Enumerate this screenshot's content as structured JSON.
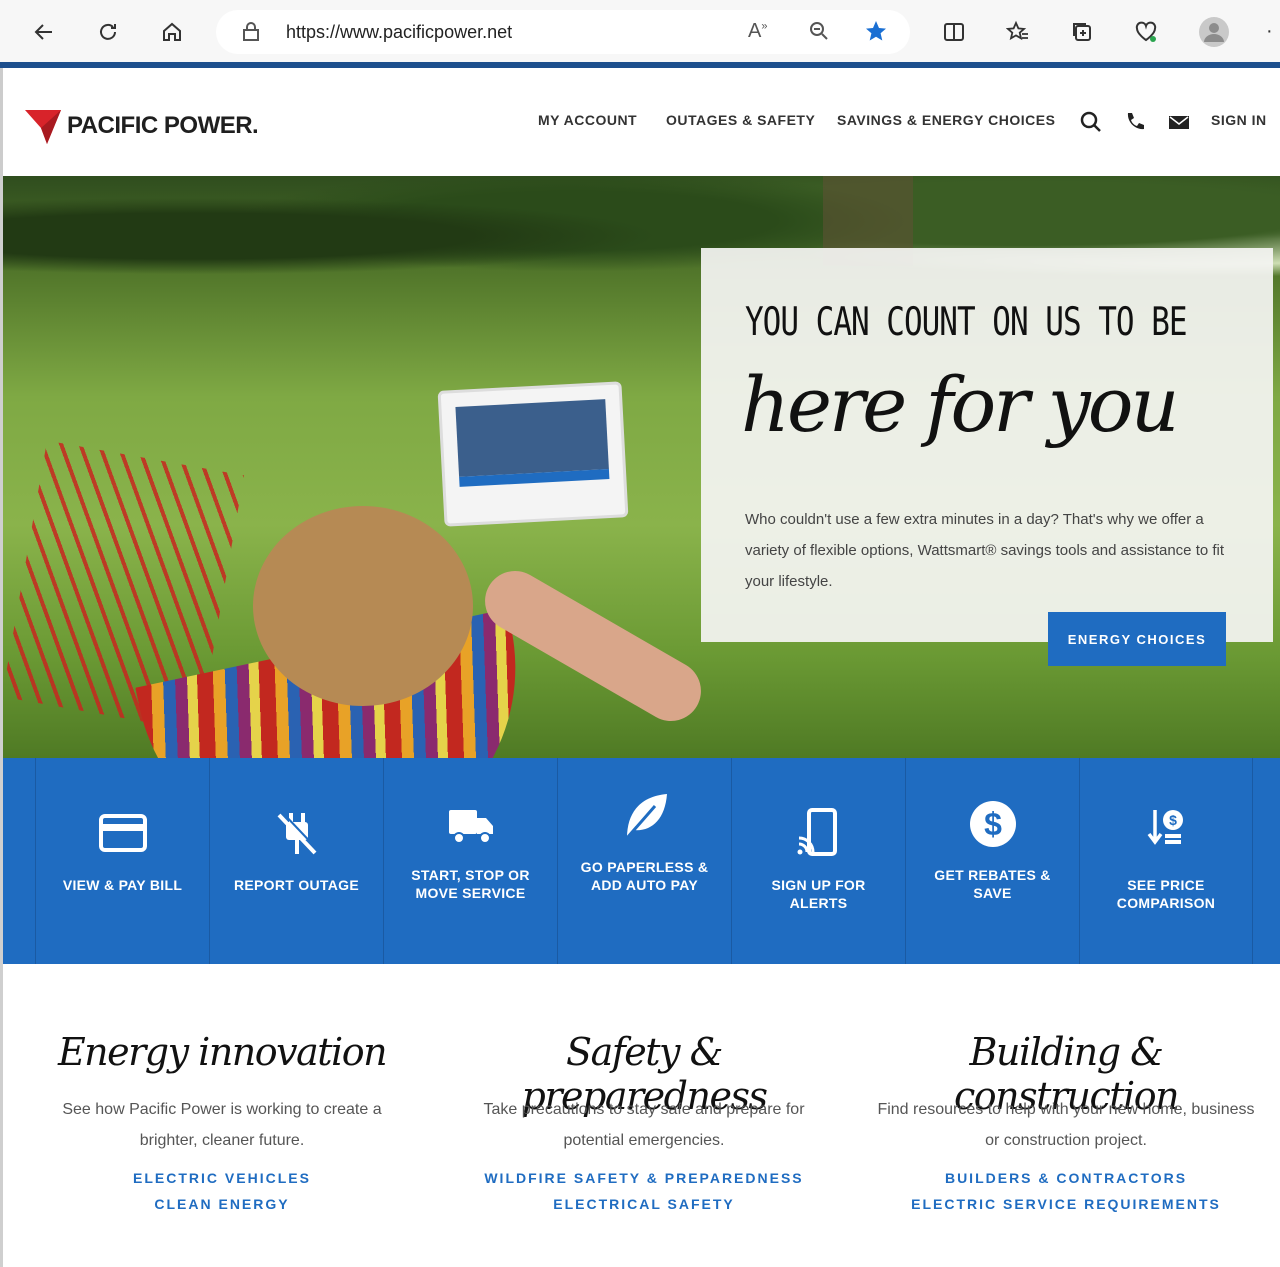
{
  "browser": {
    "url": "https://www.pacificpower.net"
  },
  "header": {
    "logo_text": "PACIFIC POWER.",
    "nav": {
      "my_account": "MY ACCOUNT",
      "outages": "OUTAGES & SAFETY",
      "savings": "SAVINGS & ENERGY CHOICES",
      "sign_in": "SIGN IN"
    }
  },
  "hero": {
    "line1": "YOU CAN COUNT ON US TO BE",
    "line2": "here for you",
    "body": "Who couldn't use a few extra minutes in a day? That's why we offer a variety of flexible options, Wattsmart® savings tools and assistance to fit your lifestyle.",
    "button": "ENERGY CHOICES"
  },
  "tiles": [
    {
      "label": "VIEW & PAY BILL",
      "icon": "credit-card-icon"
    },
    {
      "label": "REPORT OUTAGE",
      "icon": "unplugged-icon"
    },
    {
      "label": "START, STOP OR MOVE SERVICE",
      "icon": "truck-icon"
    },
    {
      "label": "GO PAPERLESS & ADD AUTO PAY",
      "icon": "leaf-icon"
    },
    {
      "label": "SIGN UP FOR ALERTS",
      "icon": "phone-alert-icon"
    },
    {
      "label": "GET REBATES & SAVE",
      "icon": "dollar-icon"
    },
    {
      "label": "SEE PRICE COMPARISON",
      "icon": "price-compare-icon"
    }
  ],
  "features": [
    {
      "title": "Energy innovation",
      "desc": "See how Pacific Power is working to create a brighter, cleaner future.",
      "links": [
        "ELECTRIC VEHICLES",
        "CLEAN ENERGY"
      ]
    },
    {
      "title": "Safety & preparedness",
      "desc": "Take precautions to stay safe and prepare for potential emergencies.",
      "links": [
        "WILDFIRE SAFETY & PREPAREDNESS",
        "ELECTRICAL SAFETY"
      ]
    },
    {
      "title": "Building & construction",
      "desc": "Find resources to help with your new home, business or construction project.",
      "links": [
        "BUILDERS & CONTRACTORS",
        "ELECTRIC SERVICE REQUIREMENTS"
      ]
    }
  ],
  "colors": {
    "brand_blue": "#1f6cc1",
    "header_rule": "#1d4f8d",
    "logo_red": "#d8232a"
  }
}
